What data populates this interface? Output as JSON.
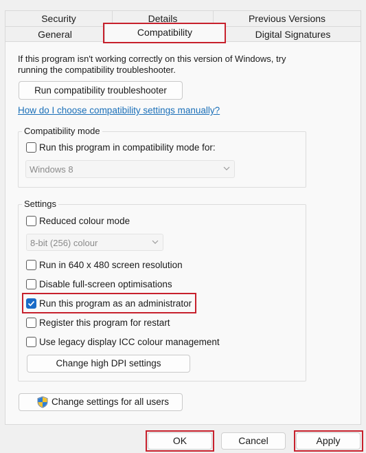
{
  "tabs": {
    "row1": [
      "Security",
      "Details",
      "Previous Versions"
    ],
    "row2": [
      "General",
      "Compatibility",
      "Digital Signatures"
    ],
    "active": "Compatibility"
  },
  "intro": {
    "line1": "If this program isn't working correctly on this version of Windows, try",
    "line2": "running the compatibility troubleshooter."
  },
  "troubleshooter_button": "Run compatibility troubleshooter",
  "help_link": "How do I choose compatibility settings manually?",
  "compat_mode": {
    "legend": "Compatibility mode",
    "checkbox_label": "Run this program in compatibility mode for:",
    "checked": false,
    "select_value": "Windows 8"
  },
  "settings": {
    "legend": "Settings",
    "reduced_colour": {
      "label": "Reduced colour mode",
      "checked": false
    },
    "colour_select_value": "8-bit (256) colour",
    "res_640": {
      "label": "Run in 640 x 480 screen resolution",
      "checked": false
    },
    "fullscreen": {
      "label": "Disable full-screen optimisations",
      "checked": false
    },
    "admin": {
      "label": "Run this program as an administrator",
      "checked": true
    },
    "restart": {
      "label": "Register this program for restart",
      "checked": false
    },
    "icc": {
      "label": "Use legacy display ICC colour management",
      "checked": false
    },
    "dpi_button": "Change high DPI settings"
  },
  "all_users_button": "Change settings for all users",
  "footer": {
    "ok": "OK",
    "cancel": "Cancel",
    "apply": "Apply"
  },
  "colors": {
    "accent": "#1a6bc7",
    "highlight": "#c7202c",
    "link": "#1a6fb8"
  }
}
